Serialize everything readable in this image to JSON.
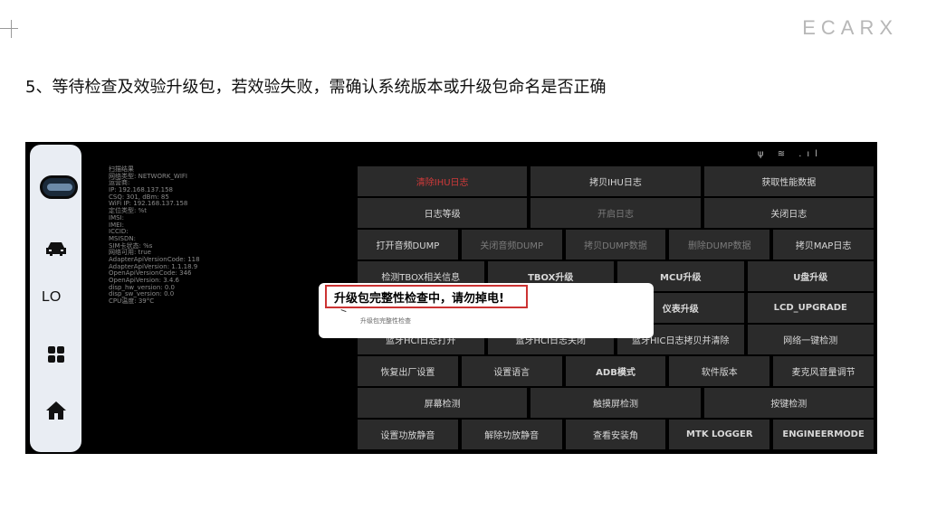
{
  "slide": {
    "logo": "ECARX",
    "title": "5、等待检查及效验升级包，若效验失败，需确认系统版本或升级包命名是否正确"
  },
  "sidebar": {
    "lo_label": "LO",
    "icons": [
      "car-icon",
      "grid-icon",
      "home-icon"
    ]
  },
  "status_bar": {
    "icons": [
      "usb-icon",
      "wifi-icon",
      "signal-icon"
    ],
    "text": "ψ ≋ .ıl"
  },
  "info_lines": [
    "扫描结果",
    "网络类型: NETWORK_WIFI",
    "运营商:",
    "IP: 192.168.137.158",
    "CSQ: 301, dBm: 85",
    "WiFi IP: 192.168.137.158",
    "定位类型: %t",
    "IMSI:",
    "IMEI:",
    "ICCID:",
    "MSISDN:",
    "SIM卡状态: %s",
    "网络可用: true",
    "AdapterApiVersionCode: 118",
    "AdapterApiVersion: 1.1.18.9",
    "OpenApiVersionCode: 346",
    "OpenApiVersion: 3.4.6",
    "disp_hw_version: 0.0",
    "disp_sw_version: 0.0",
    "CPU温度: 39°C"
  ],
  "button_rows": [
    [
      {
        "label": "清除IHU日志",
        "style": "red"
      },
      {
        "label": "拷贝IHU日志",
        "style": ""
      },
      {
        "label": "获取性能数据",
        "style": ""
      }
    ],
    [
      {
        "label": "日志等级",
        "style": ""
      },
      {
        "label": "开启日志",
        "style": "dim"
      },
      {
        "label": "关闭日志",
        "style": ""
      }
    ],
    [
      {
        "label": "打开音频DUMP",
        "style": ""
      },
      {
        "label": "关闭音频DUMP",
        "style": "dim"
      },
      {
        "label": "拷贝DUMP数据",
        "style": "dim"
      },
      {
        "label": "删除DUMP数据",
        "style": "dim"
      },
      {
        "label": "拷贝MAP日志",
        "style": ""
      }
    ],
    [
      {
        "label": "检测TBOX相关信息",
        "style": ""
      },
      {
        "label": "TBOX升级",
        "style": "bold"
      },
      {
        "label": "MCU升级",
        "style": "bold"
      },
      {
        "label": "U盘升级",
        "style": "bold"
      }
    ],
    [
      {
        "label": "",
        "style": ""
      },
      {
        "label": "",
        "style": ""
      },
      {
        "label": "仪表升级",
        "style": "bold"
      },
      {
        "label": "LCD_UPGRADE",
        "style": "bold"
      }
    ],
    [
      {
        "label": "蓝牙HCI日志打开",
        "style": ""
      },
      {
        "label": "蓝牙HCI日志关闭",
        "style": ""
      },
      {
        "label": "蓝牙HIC日志拷贝并清除",
        "style": ""
      },
      {
        "label": "网络一键检测",
        "style": ""
      }
    ],
    [
      {
        "label": "恢复出厂设置",
        "style": ""
      },
      {
        "label": "设置语言",
        "style": ""
      },
      {
        "label": "ADB模式",
        "style": "bold"
      },
      {
        "label": "软件版本",
        "style": ""
      },
      {
        "label": "麦克风音量调节",
        "style": ""
      }
    ],
    [
      {
        "label": "屏幕检测",
        "style": ""
      },
      {
        "label": "触摸屏检测",
        "style": ""
      },
      {
        "label": "按键检测",
        "style": ""
      }
    ],
    [
      {
        "label": "设置功放静音",
        "style": ""
      },
      {
        "label": "解除功放静音",
        "style": ""
      },
      {
        "label": "查看安装角",
        "style": ""
      },
      {
        "label": "MTK LOGGER",
        "style": "bold"
      },
      {
        "label": "ENGINEERMODE",
        "style": "bold"
      }
    ]
  ],
  "dialog": {
    "title": "升级包完整性检查中，请勿掉电!",
    "subtitle": "升级包完整性检查"
  }
}
